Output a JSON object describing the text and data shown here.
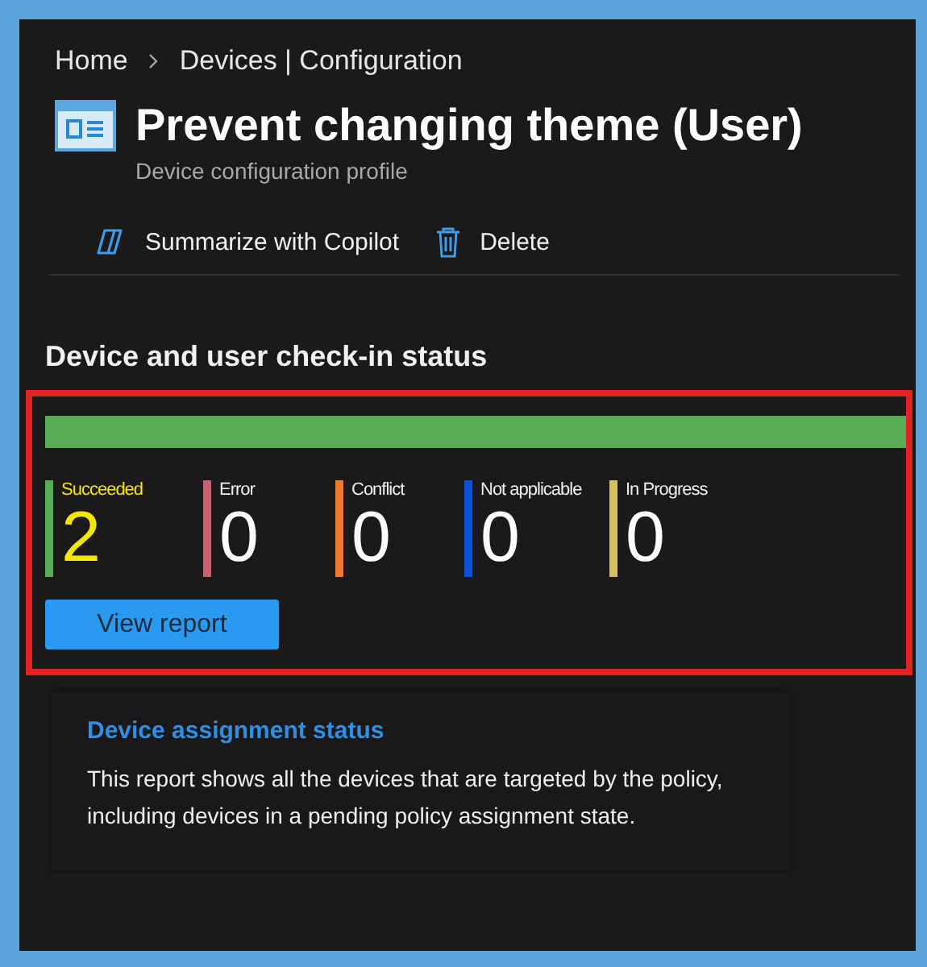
{
  "breadcrumb": [
    {
      "label": "Home"
    },
    {
      "label": "Devices | Configuration"
    }
  ],
  "header": {
    "title": "Prevent changing theme (User)",
    "subtitle": "Device configuration profile"
  },
  "toolbar": [
    {
      "kind": "copilot",
      "label": "Summarize with Copilot"
    },
    {
      "kind": "delete",
      "label": "Delete"
    }
  ],
  "checkin": {
    "heading": "Device and user check-in status",
    "bar": [
      {
        "color": "#57ad56",
        "level": 1
      }
    ],
    "statuses": [
      {
        "label": "Succeeded",
        "count": "2",
        "color": "#57ad56",
        "highlighted": true
      },
      {
        "label": "Error",
        "count": "0",
        "color": "#c9606f",
        "highlighted": false
      },
      {
        "label": "Conflict",
        "count": "0",
        "color": "#f0782f",
        "highlighted": false
      },
      {
        "label": "Not applicable",
        "count": "0",
        "color": "#0b50d6",
        "highlighted": false
      },
      {
        "label": "In Progress",
        "count": "0",
        "color": "#d4c060",
        "highlighted": false
      }
    ],
    "button": "View report"
  },
  "card": {
    "title": "Device assignment status",
    "text": "This report shows all the devices that are targeted by the policy, including devices in a pending policy assignment state."
  }
}
